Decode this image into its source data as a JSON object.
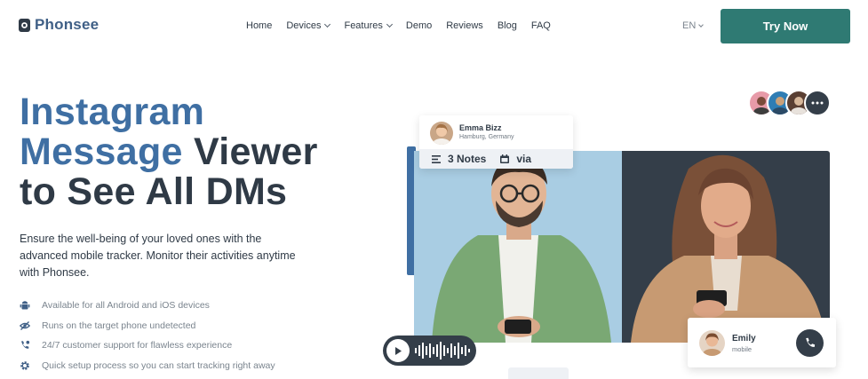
{
  "brand": {
    "name": "Phonsee",
    "color": "#3f5f86",
    "icon": "phone-logo-icon"
  },
  "nav": {
    "items": [
      {
        "label": "Home",
        "has_dropdown": false
      },
      {
        "label": "Devices",
        "has_dropdown": true
      },
      {
        "label": "Features",
        "has_dropdown": true
      },
      {
        "label": "Demo",
        "has_dropdown": false
      },
      {
        "label": "Reviews",
        "has_dropdown": false
      },
      {
        "label": "Blog",
        "has_dropdown": false
      },
      {
        "label": "FAQ",
        "has_dropdown": false
      }
    ],
    "language": "EN",
    "cta_label": "Try Now",
    "cta_color": "#2f7a73"
  },
  "hero": {
    "headline_accent_1": "Instagram",
    "headline_accent_2": "Message",
    "headline_rest_1": "Viewer",
    "headline_rest_2": "to See All DMs",
    "accent_color": "#3f6fa3",
    "description": "Ensure the well-being of your loved ones with the advanced mobile tracker. Monitor their activities anytime with Phonsee.",
    "features": [
      {
        "icon": "android-icon",
        "text": "Available for all Android and iOS devices"
      },
      {
        "icon": "eye-slash-icon",
        "text": "Runs on the target phone undetected"
      },
      {
        "icon": "support-phone-icon",
        "text": "24/7 customer support for flawless experience"
      },
      {
        "icon": "gear-icon",
        "text": "Quick setup process so you can start tracking right away"
      }
    ]
  },
  "visual": {
    "profile_card": {
      "name": "Emma Bizz",
      "location": "Hamburg, Germany",
      "notes": "3 Notes",
      "via": "via"
    },
    "call_card": {
      "name": "Emily",
      "subtitle": "mobile"
    }
  }
}
